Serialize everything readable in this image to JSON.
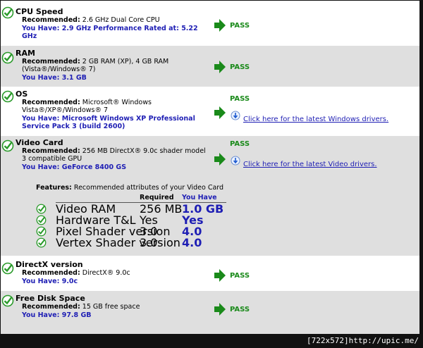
{
  "rows": [
    {
      "title": "CPU Speed",
      "rec_label": "Recommended:",
      "rec_value": "2.6 GHz Dual Core CPU",
      "have_line1": "You Have: 2.9 GHz Performance Rated at: 5.22",
      "have_line2": "GHz",
      "status": "PASS"
    },
    {
      "title": "RAM",
      "rec_label": "Recommended:",
      "rec_value": "2 GB RAM (XP), 4 GB RAM",
      "rec_value2": "(Vista®/Windows® 7)",
      "have_line1": "You Have: 3.1 GB",
      "status": "PASS"
    },
    {
      "title": "OS",
      "rec_label": "Recommended:",
      "rec_value": "Microsoft® Windows",
      "rec_value2": "Vista®/XP®/Windows® 7",
      "have_line1": "You Have: Microsoft Windows XP Professional",
      "have_line2": "Service Pack 3 (build 2600)",
      "status": "PASS",
      "link": "Click here for the latest Windows drivers."
    },
    {
      "title": "Video Card",
      "rec_label": "Recommended:",
      "rec_value": "256 MB DirectX® 9.0c shader model",
      "rec_value2": "3 compatible GPU",
      "have_line1": "You Have: GeForce 8400 GS",
      "status": "PASS",
      "link": "Click here for the latest Video drivers.",
      "features": {
        "label": "Features:",
        "desc": "Recommended attributes of your Video Card",
        "col_required": "Required",
        "col_have": "You Have",
        "items": [
          {
            "name": "Video RAM",
            "required": "256 MB",
            "have": "1.0 GB"
          },
          {
            "name": "Hardware T&L",
            "required": "Yes",
            "have": "Yes"
          },
          {
            "name": "Pixel Shader version",
            "required": "3.0",
            "have": "4.0"
          },
          {
            "name": "Vertex Shader version",
            "required": "3.0",
            "have": "4.0"
          }
        ]
      }
    },
    {
      "title": "DirectX version",
      "rec_label": "Recommended:",
      "rec_value": "DirectX® 9.0c",
      "have_line1": "You Have: 9.0c",
      "status": "PASS"
    },
    {
      "title": "Free Disk Space",
      "rec_label": "Recommended:",
      "rec_value": "15 GB free space",
      "have_line1": "You Have: 97.8 GB",
      "status": "PASS"
    }
  ],
  "footer": "[722x572]http://upic.me/",
  "colors": {
    "check_green": "#2a9a2a",
    "pass_green": "#1a8a1a",
    "link_blue": "#1e1eb4",
    "row_shade": "#dfdfdf"
  }
}
